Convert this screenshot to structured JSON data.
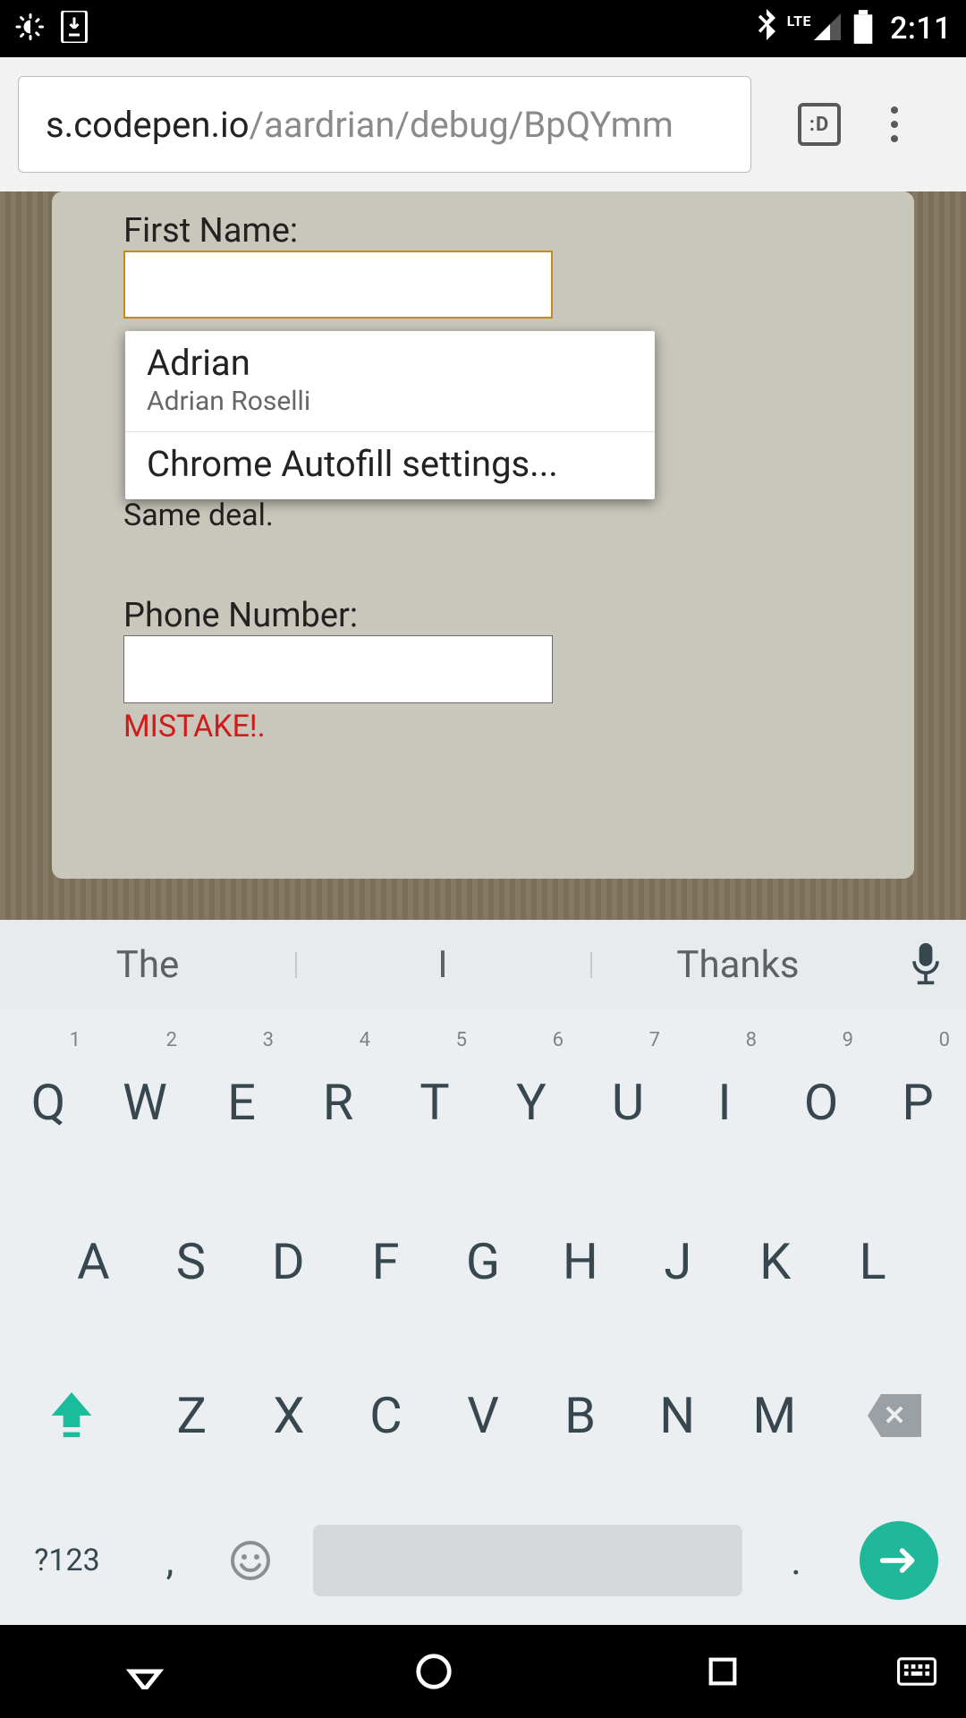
{
  "statusBar": {
    "clock": "2:11",
    "lte": "LTE"
  },
  "browser": {
    "urlHost": "s.codepen.io",
    "urlPath": "/aardrian/debug/BpQYmm",
    "tabCount": ":D"
  },
  "form": {
    "label1": "First Name:",
    "help1": "Same deal.",
    "label2": "Phone Number:",
    "error2": "MISTAKE!."
  },
  "autofill": {
    "primary": "Adrian",
    "secondary": "Adrian Roselli",
    "settings": "Chrome Autofill settings..."
  },
  "suggestions": {
    "a": "The",
    "b": "I",
    "c": "Thanks"
  },
  "keys": {
    "row1": [
      "Q",
      "W",
      "E",
      "R",
      "T",
      "Y",
      "U",
      "I",
      "O",
      "P"
    ],
    "nums": [
      "1",
      "2",
      "3",
      "4",
      "5",
      "6",
      "7",
      "8",
      "9",
      "0"
    ],
    "row2": [
      "A",
      "S",
      "D",
      "F",
      "G",
      "H",
      "J",
      "K",
      "L"
    ],
    "row3": [
      "Z",
      "X",
      "C",
      "V",
      "B",
      "N",
      "M"
    ],
    "sym": "?123",
    "comma": ",",
    "period": "."
  }
}
